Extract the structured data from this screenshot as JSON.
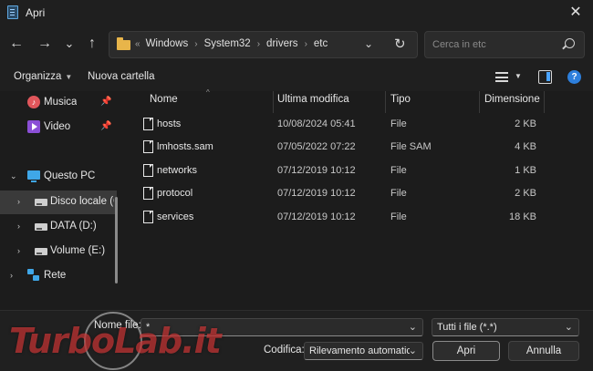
{
  "window": {
    "title": "Apri",
    "close_glyph": "✕"
  },
  "nav": {
    "back_glyph": "←",
    "forward_glyph": "→",
    "recent_glyph": "⌄",
    "up_glyph": "↑",
    "breadcrumb_lead": "«",
    "breadcrumb": [
      "Windows",
      "System32",
      "drivers",
      "etc"
    ],
    "breadcrumb_sep": "›",
    "address_dropdown_glyph": "⌄",
    "refresh_glyph": "↻",
    "search_placeholder": "Cerca in etc"
  },
  "toolbar": {
    "organize_label": "Organizza",
    "organize_caret": "▼",
    "new_folder_label": "Nuova cartella",
    "view_caret": "▼",
    "help_glyph": "?"
  },
  "sidebar": {
    "pin_glyph": "📌",
    "collapsed_glyph": "›",
    "expanded_glyph": "⌄",
    "music_glyph": "♪",
    "items": [
      {
        "label": "Musica"
      },
      {
        "label": "Video"
      },
      {
        "label": "Questo PC"
      },
      {
        "label": "Disco locale (C:)"
      },
      {
        "label": "DATA (D:)"
      },
      {
        "label": "Volume (E:)"
      },
      {
        "label": "Rete"
      }
    ]
  },
  "files": {
    "sort_glyph": "^",
    "columns": {
      "name": "Nome",
      "modified": "Ultima modifica",
      "type": "Tipo",
      "size": "Dimensione"
    },
    "rows": [
      {
        "name": "hosts",
        "modified": "10/08/2024 05:41",
        "type": "File",
        "size": "2 KB"
      },
      {
        "name": "lmhosts.sam",
        "modified": "07/05/2022 07:22",
        "type": "File SAM",
        "size": "4 KB"
      },
      {
        "name": "networks",
        "modified": "07/12/2019 10:12",
        "type": "File",
        "size": "1 KB"
      },
      {
        "name": "protocol",
        "modified": "07/12/2019 10:12",
        "type": "File",
        "size": "2 KB"
      },
      {
        "name": "services",
        "modified": "07/12/2019 10:12",
        "type": "File",
        "size": "18 KB"
      }
    ]
  },
  "bottom": {
    "filename_label": "Nome file:",
    "filename_value": "*",
    "dropdown_glyph": "⌄",
    "filetype_value": "Tutti i file  (*.*)",
    "encoding_label": "Codifica:",
    "encoding_value": "Rilevamento automatico",
    "open_label": "Apri",
    "cancel_label": "Annulla"
  },
  "watermark": {
    "text": "TurboLab.it"
  }
}
